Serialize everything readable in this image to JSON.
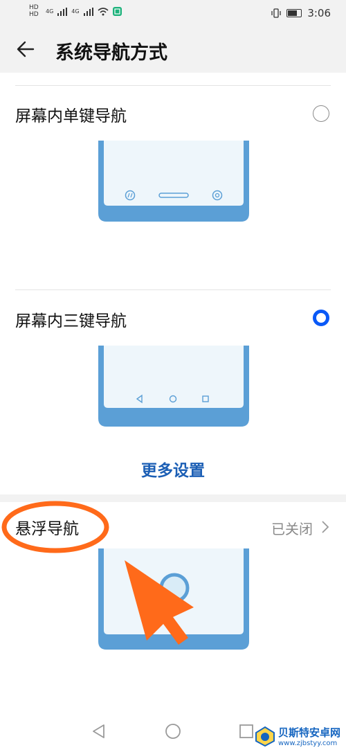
{
  "status_bar": {
    "hd1": "HD",
    "hd2": "HD",
    "net1": "4G",
    "net2": "4G",
    "time": "3:06"
  },
  "header": {
    "title": "系统导航方式"
  },
  "options": [
    {
      "label": "屏幕内单键导航",
      "selected": false
    },
    {
      "label": "屏幕内三键导航",
      "selected": true
    }
  ],
  "more_settings": "更多设置",
  "floating_nav": {
    "label": "悬浮导航",
    "status": "已关闭"
  },
  "watermark": {
    "name": "贝斯特安卓网",
    "url": "www.zjbstyy.com"
  },
  "colors": {
    "accent": "#0a59f7",
    "phone_frame": "#5b9fd6",
    "phone_screen": "#eef6fb",
    "annotation": "#ff6a1a"
  }
}
